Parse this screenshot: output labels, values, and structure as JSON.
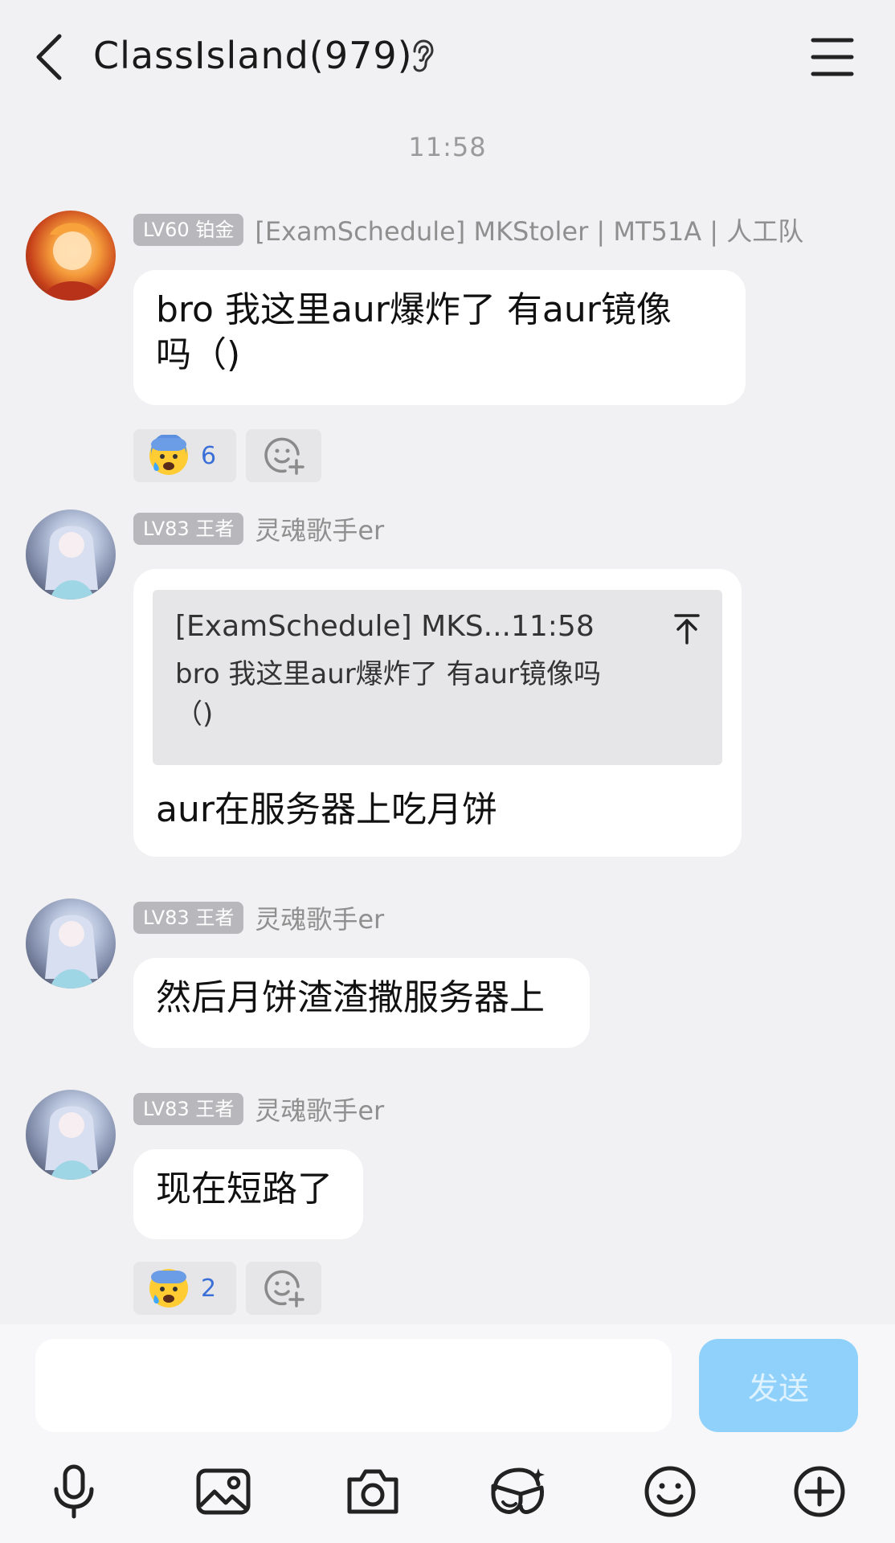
{
  "header": {
    "title": "ClassIsland(979)"
  },
  "timestamp": "11:58",
  "messages": [
    {
      "badge": "LV60 铂金",
      "nickname": "[ExamSchedule] MKStoler | MT51A | 人工队",
      "text_line1": "bro 我这里aur爆炸了 有aur镜像",
      "text_line2": "吗（)",
      "reaction_count": "6"
    },
    {
      "badge": "LV83 王者",
      "nickname": "灵魂歌手er",
      "quote_head": "[ExamSchedule] MKS...11:58",
      "quote_body_line1": "bro 我这里aur爆炸了 有aur镜像吗",
      "quote_body_line2": "（)",
      "text": "aur在服务器上吃月饼"
    },
    {
      "badge": "LV83 王者",
      "nickname": "灵魂歌手er",
      "text": "然后月饼渣渣撒服务器上"
    },
    {
      "badge": "LV83 王者",
      "nickname": "灵魂歌手er",
      "text": "现在短路了",
      "reaction_count": "2"
    }
  ],
  "composer": {
    "placeholder": "",
    "send_label": "发送"
  },
  "toolbar": [
    "mic-icon",
    "image-icon",
    "camera-icon",
    "sticker-icon",
    "emoji-icon",
    "plus-icon"
  ],
  "colors": {
    "background": "#f1f1f3",
    "send_button": "#8fd1fb",
    "reaction_count": "#3b6fd8"
  }
}
